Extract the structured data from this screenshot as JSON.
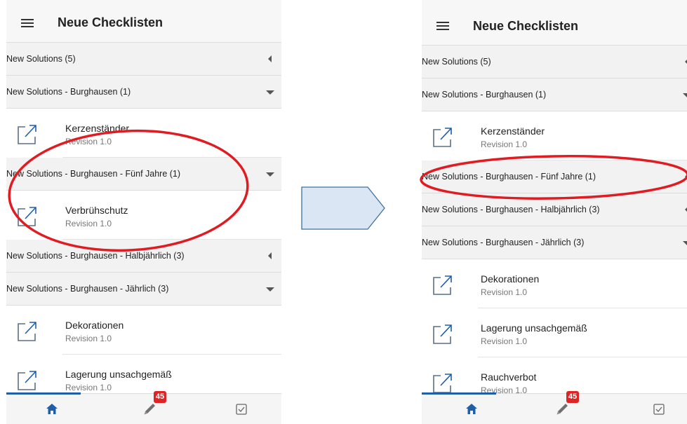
{
  "colors": {
    "accent": "#1f5ea8",
    "badge": "#e02424",
    "annotation": "#e01b22",
    "arrow_fill": "#dbe6f4",
    "arrow_stroke": "#41719c"
  },
  "icons": {
    "menu": "hamburger-icon",
    "item": "external-link-icon",
    "home": "home-icon",
    "edit": "pencil-icon",
    "tasks": "checkbox-icon"
  },
  "left": {
    "title": "Neue Checklisten",
    "groups": [
      {
        "label": "New Solutions (5)",
        "state": "collapsed"
      },
      {
        "label": "New Solutions - Burghausen (1)",
        "state": "expanded",
        "items": [
          {
            "name": "Kerzenständer",
            "revision": "Revision 1.0"
          }
        ]
      },
      {
        "label": "New Solutions - Burghausen - Fünf Jahre (1)",
        "state": "expanded",
        "items": [
          {
            "name": "Verbrühschutz",
            "revision": "Revision 1.0"
          }
        ]
      },
      {
        "label": "New Solutions - Burghausen - Halbjährlich (3)",
        "state": "collapsed"
      },
      {
        "label": "New Solutions - Burghausen - Jährlich (3)",
        "state": "expanded",
        "items": [
          {
            "name": "Dekorationen",
            "revision": "Revision 1.0"
          },
          {
            "name": "Lagerung unsachgemäß",
            "revision": "Revision 1.0"
          }
        ]
      }
    ],
    "badge_count": "45"
  },
  "right": {
    "title": "Neue Checklisten",
    "groups": [
      {
        "label": "New Solutions (5)",
        "state": "collapsed"
      },
      {
        "label": "New Solutions - Burghausen (1)",
        "state": "expanded",
        "items": [
          {
            "name": "Kerzenständer",
            "revision": "Revision 1.0"
          }
        ]
      },
      {
        "label": "New Solutions - Burghausen - Fünf Jahre (1)",
        "state": "collapsed"
      },
      {
        "label": "New Solutions - Burghausen - Halbjährlich (3)",
        "state": "collapsed"
      },
      {
        "label": "New Solutions - Burghausen - Jährlich (3)",
        "state": "expanded",
        "items": [
          {
            "name": "Dekorationen",
            "revision": "Revision 1.0"
          },
          {
            "name": "Lagerung unsachgemäß",
            "revision": "Revision 1.0"
          },
          {
            "name": "Rauchverbot",
            "revision": "Revision 1.0"
          }
        ]
      }
    ],
    "badge_count": "45"
  }
}
